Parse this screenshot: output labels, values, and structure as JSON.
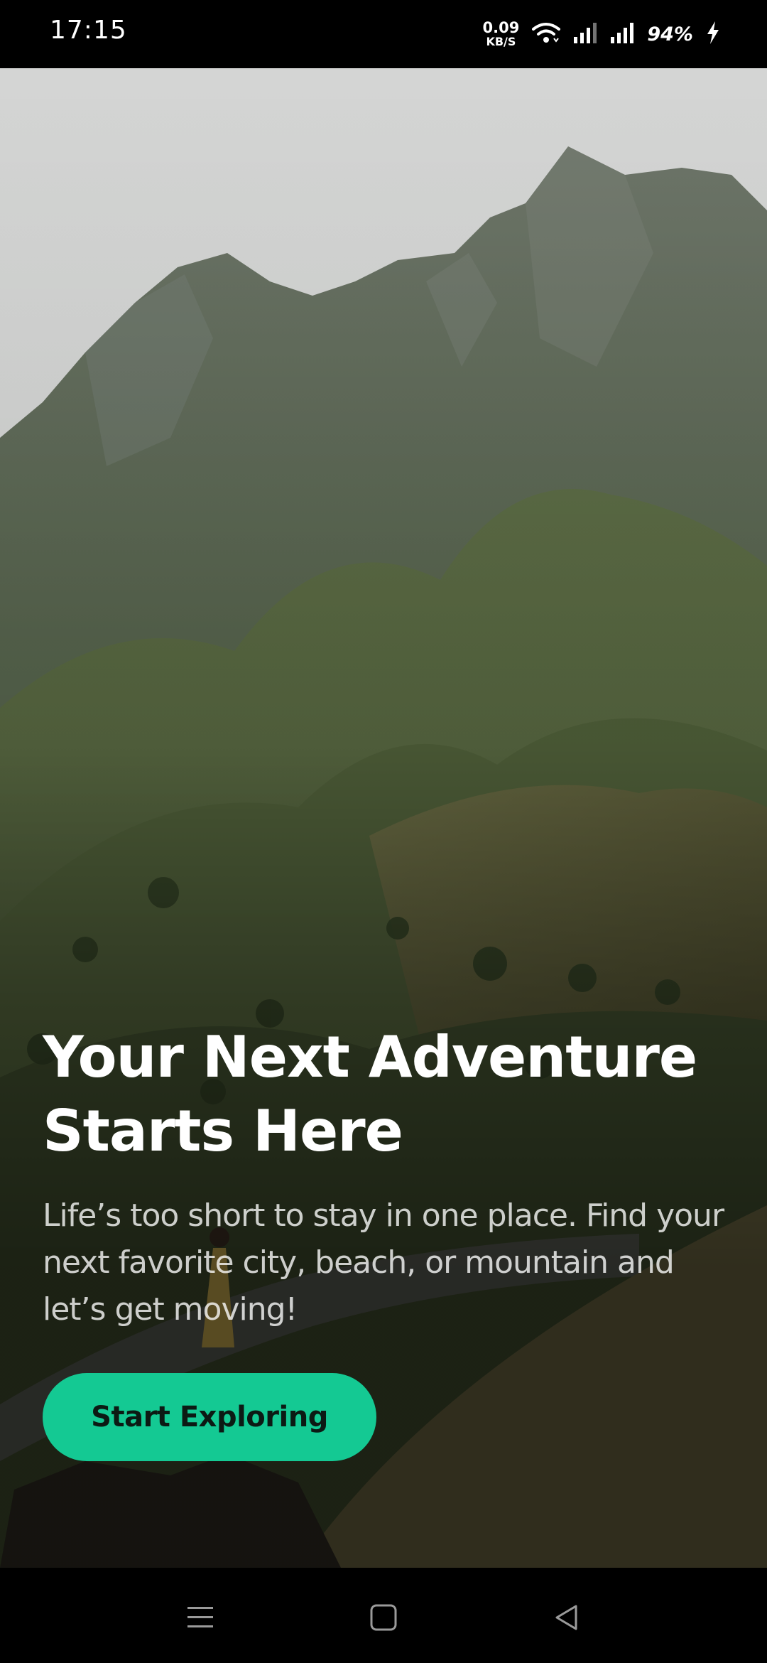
{
  "status_bar": {
    "time": "17:15",
    "net_speed_value": "0.09",
    "net_speed_unit": "KB/S",
    "battery_percent": "94%",
    "icons": [
      "wifi-icon",
      "signal-icon",
      "signal-icon",
      "charging-icon"
    ]
  },
  "hero": {
    "image": "mountain-landscape-photo",
    "headline": "Your Next Adventure Starts Here",
    "subtitle": "Life’s too short to stay in one place. Find your next favorite city, beach, or mountain and let’s get moving!",
    "cta_label": "Start Exploring"
  },
  "nav_bar": {
    "icons": [
      "menu-icon",
      "home-icon",
      "back-icon"
    ]
  },
  "colors": {
    "accent": "#14c993",
    "button_text": "#0c1a14",
    "bar_background": "#000000"
  }
}
